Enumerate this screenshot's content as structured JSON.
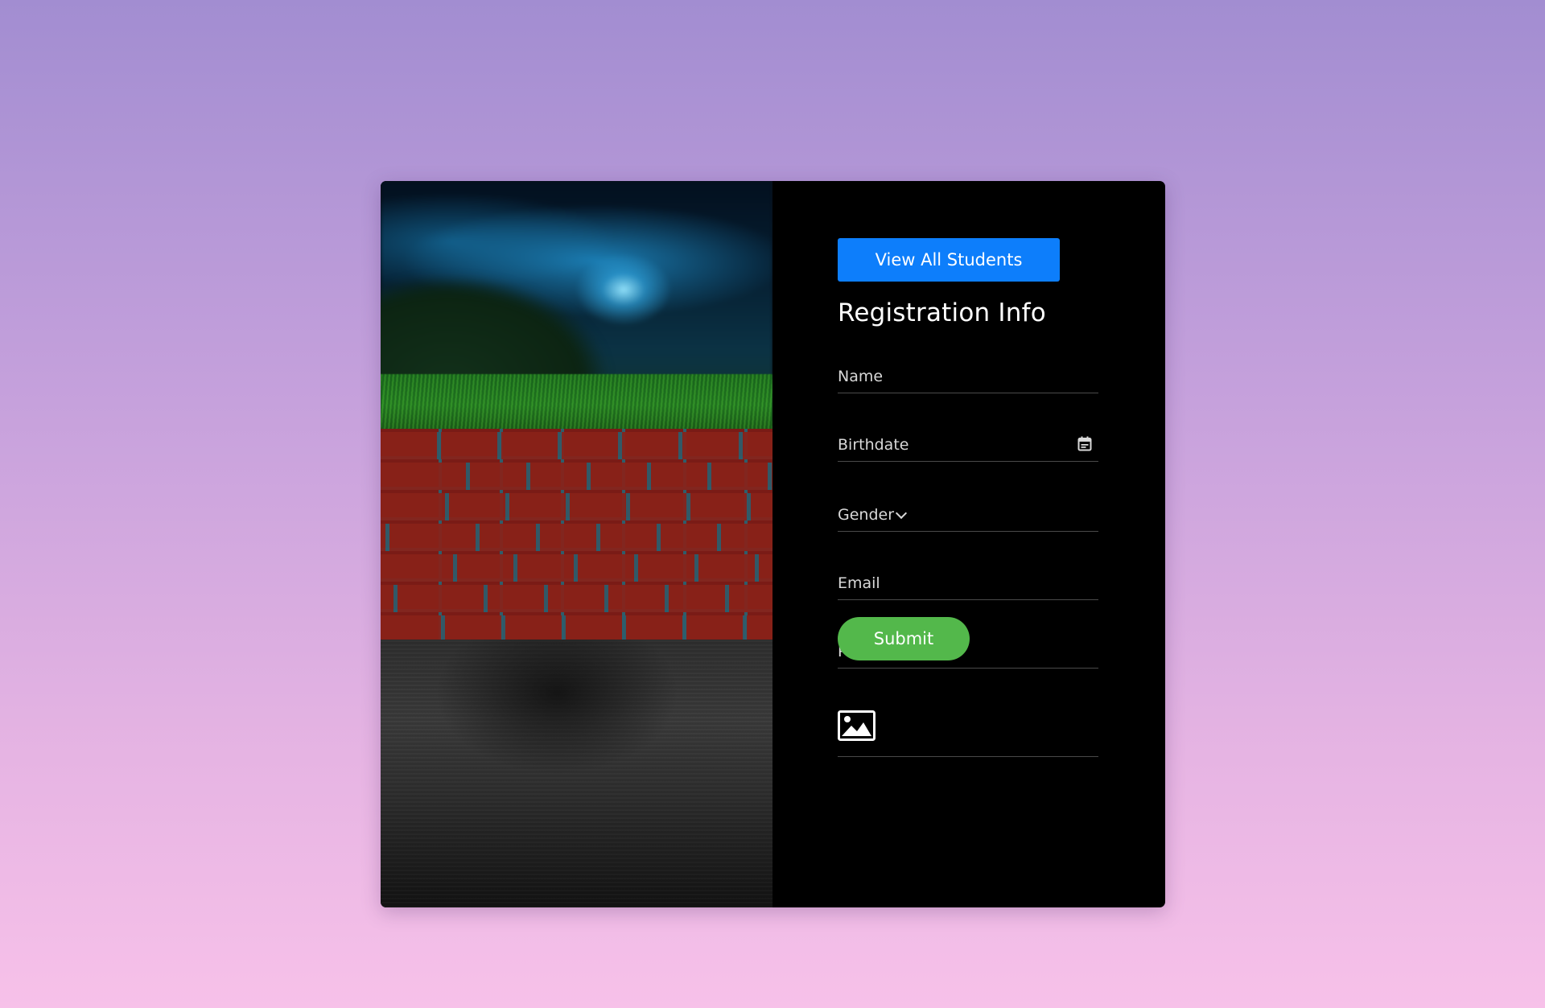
{
  "nav": {
    "view_all_label": "View All Students"
  },
  "form": {
    "title": "Registration Info",
    "name_placeholder": "Name",
    "birthdate_label": "Birthdate",
    "gender_label": "Gender",
    "email_placeholder": "Email",
    "phone_placeholder": "Phone",
    "photo_icon": "image-icon",
    "submit_label": "Submit"
  },
  "colors": {
    "primary_button": "#0d7efb",
    "submit_button": "#53b84b",
    "card_background": "#000000"
  },
  "icons": {
    "birthdate": "calendar-icon",
    "gender": "chevron-down-icon",
    "photo": "image-icon"
  }
}
